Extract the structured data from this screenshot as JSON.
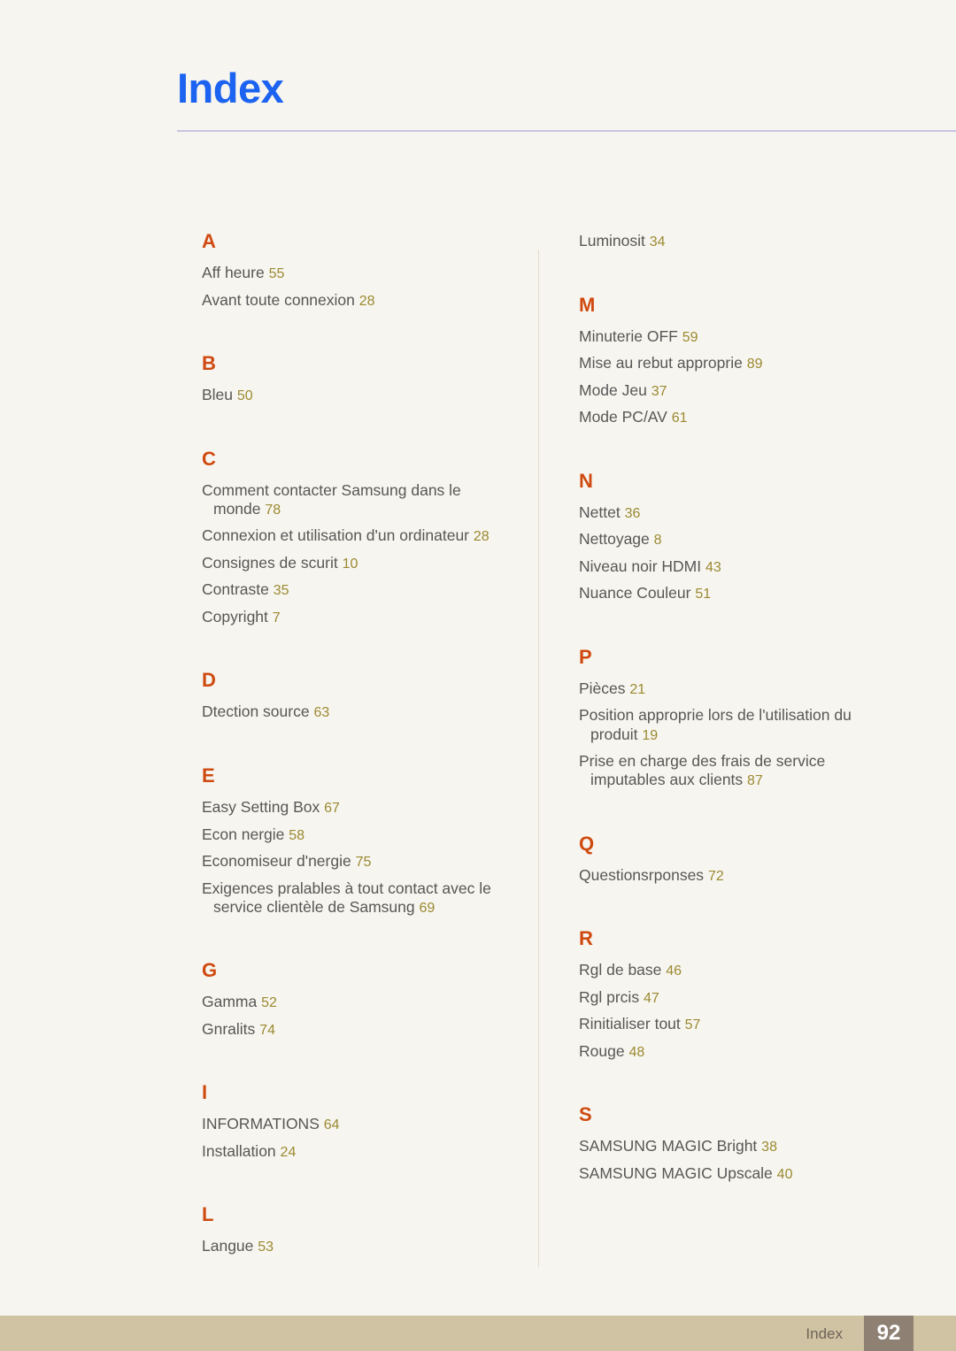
{
  "header": {
    "title": "Index",
    "title_color": "#1b63f0",
    "rule_color": "#c9c3e2"
  },
  "theme": {
    "background": "#f7f5ef",
    "letter_heading_color": "#cf4a10",
    "entry_text_color": "#575757",
    "page_number_color": "#9b8a33",
    "footer_bar_color": "#d0c3a3",
    "footer_box_color": "#8e8174"
  },
  "index": {
    "left_column": [
      {
        "letter": "A",
        "entries": [
          {
            "text": "Aff heure",
            "page": "55"
          },
          {
            "text": "Avant toute connexion",
            "page": "28"
          }
        ]
      },
      {
        "letter": "B",
        "entries": [
          {
            "text": "Bleu",
            "page": "50"
          }
        ]
      },
      {
        "letter": "C",
        "entries": [
          {
            "text": "Comment contacter Samsung dans le",
            "cont": "monde",
            "page": "78"
          },
          {
            "text": "Connexion et utilisation d'un ordinateur",
            "page": "28"
          },
          {
            "text": "Consignes de scurit",
            "page": "10"
          },
          {
            "text": "Contraste",
            "page": "35"
          },
          {
            "text": "Copyright",
            "page": "7"
          }
        ]
      },
      {
        "letter": "D",
        "entries": [
          {
            "text": "Dtection source",
            "page": "63"
          }
        ]
      },
      {
        "letter": "E",
        "entries": [
          {
            "text": "Easy Setting Box",
            "page": "67"
          },
          {
            "text": "Econ nergie",
            "page": "58"
          },
          {
            "text": "Economiseur d'nergie",
            "page": "75"
          },
          {
            "text": "Exigences pralables à tout contact avec le",
            "cont": "service clientèle de Samsung",
            "page": "69"
          }
        ]
      },
      {
        "letter": "G",
        "entries": [
          {
            "text": "Gamma",
            "page": "52"
          },
          {
            "text": "Gnralits",
            "page": "74"
          }
        ]
      },
      {
        "letter": "I",
        "entries": [
          {
            "text": "INFORMATIONS",
            "page": "64"
          },
          {
            "text": "Installation",
            "page": "24"
          }
        ]
      },
      {
        "letter": "L",
        "entries": [
          {
            "text": "Langue",
            "page": "53"
          }
        ]
      }
    ],
    "right_column_orphan": {
      "text": "Luminosit",
      "page": "34"
    },
    "right_column": [
      {
        "letter": "M",
        "entries": [
          {
            "text": "Minuterie OFF",
            "page": "59"
          },
          {
            "text": "Mise au rebut approprie",
            "page": "89"
          },
          {
            "text": "Mode Jeu",
            "page": "37"
          },
          {
            "text": "Mode PC/AV",
            "page": "61"
          }
        ]
      },
      {
        "letter": "N",
        "entries": [
          {
            "text": "Nettet",
            "page": "36"
          },
          {
            "text": "Nettoyage",
            "page": "8"
          },
          {
            "text": "Niveau noir HDMI",
            "page": "43"
          },
          {
            "text": "Nuance Couleur",
            "page": "51"
          }
        ]
      },
      {
        "letter": "P",
        "entries": [
          {
            "text": "Pièces",
            "page": "21"
          },
          {
            "text": "Position approprie lors de l'utilisation du",
            "cont": "produit",
            "page": "19"
          },
          {
            "text": "Prise en charge des frais de service",
            "cont": "imputables aux clients",
            "page": "87"
          }
        ]
      },
      {
        "letter": "Q",
        "entries": [
          {
            "text": "Questionsrponses",
            "page": "72"
          }
        ]
      },
      {
        "letter": "R",
        "entries": [
          {
            "text": "Rgl de base",
            "page": "46"
          },
          {
            "text": "Rgl prcis",
            "page": "47"
          },
          {
            "text": "Rinitialiser tout",
            "page": "57"
          },
          {
            "text": "Rouge",
            "page": "48"
          }
        ]
      },
      {
        "letter": "S",
        "entries": [
          {
            "text": "SAMSUNG MAGIC Bright",
            "page": "38"
          },
          {
            "text": "SAMSUNG MAGIC Upscale",
            "page": "40"
          }
        ]
      }
    ]
  },
  "footer": {
    "label": "Index",
    "page_number": "92"
  }
}
